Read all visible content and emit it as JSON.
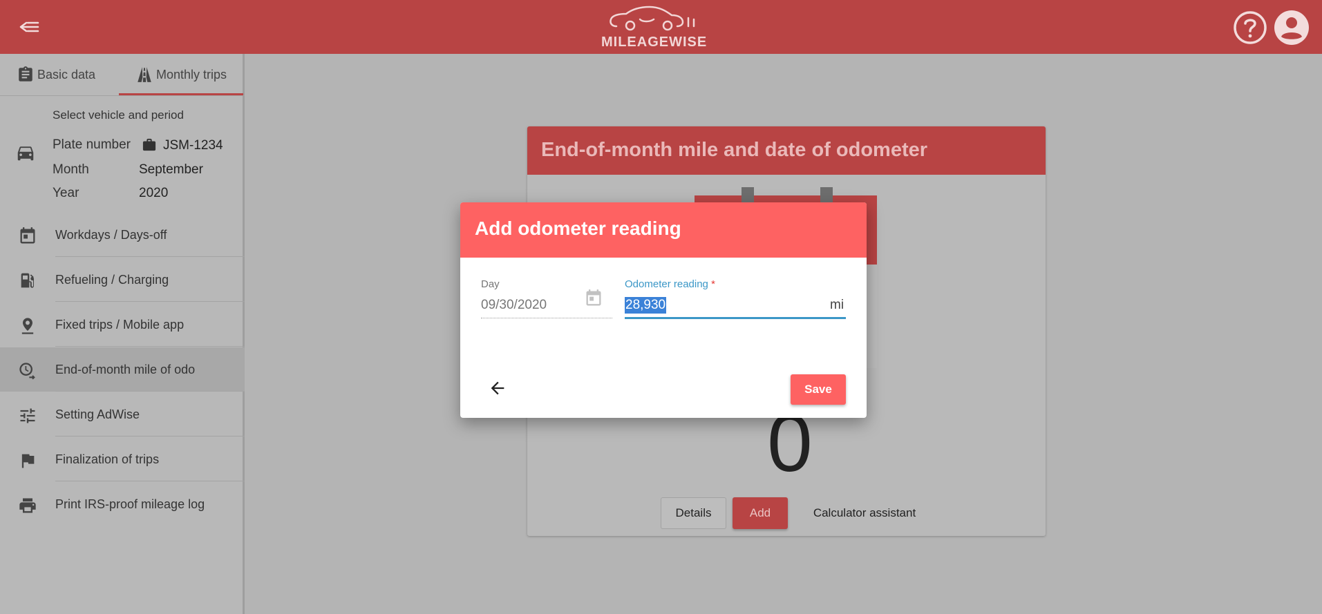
{
  "app": {
    "logo_text": "MILEAGEWISE"
  },
  "sidebar": {
    "tabs": [
      {
        "label": "Basic data"
      },
      {
        "label": "Monthly trips",
        "active": true
      }
    ],
    "vehicle": {
      "title": "Select vehicle and period",
      "plate_label": "Plate number",
      "plate_value": "JSM-1234",
      "month_label": "Month",
      "month_value": "September",
      "year_label": "Year",
      "year_value": "2020"
    },
    "items": [
      {
        "label": "Workdays / Days-off",
        "icon": "calendar-icon"
      },
      {
        "label": "Refueling / Charging",
        "icon": "fuel-icon"
      },
      {
        "label": "Fixed trips / Mobile app",
        "icon": "location-pin-icon"
      },
      {
        "label": "End-of-month mile of odo",
        "icon": "odometer-icon",
        "active": true
      },
      {
        "label": "Setting AdWise",
        "icon": "sliders-icon"
      },
      {
        "label": "Finalization of trips",
        "icon": "flag-icon"
      },
      {
        "label": "Print IRS-proof mileage log",
        "icon": "printer-icon"
      }
    ]
  },
  "card": {
    "title": "End-of-month mile and date of odometer",
    "value": "0",
    "details_label": "Details",
    "add_label": "Add",
    "calculator_label": "Calculator assistant"
  },
  "modal": {
    "title": "Add odometer reading",
    "day_label": "Day",
    "day_value": "09/30/2020",
    "odometer_label": "Odometer reading",
    "required_mark": "*",
    "odometer_value": "28,930",
    "unit": "mi",
    "save_label": "Save"
  },
  "colors": {
    "topbar": "#b84444",
    "modal_header": "#fe6262",
    "accent_blue": "#3b97c7"
  }
}
